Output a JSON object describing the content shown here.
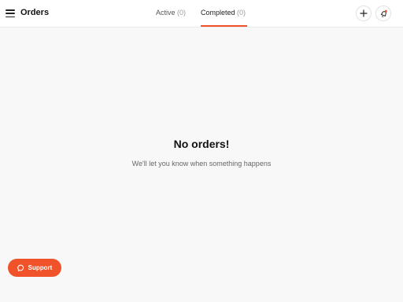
{
  "header": {
    "title": "Orders",
    "menu_icon": "hamburger-icon",
    "add_icon": "plus-icon",
    "notify_icon": "bell-icon",
    "accent_color": "#f0532a"
  },
  "tabs": [
    {
      "label": "Active",
      "count": "(0)",
      "selected": false
    },
    {
      "label": "Completed",
      "count": "(0)",
      "selected": true
    }
  ],
  "empty_state": {
    "title": "No orders!",
    "subtitle": "We'll let you know when something happens"
  },
  "support": {
    "label": "Support",
    "icon": "chat-bubble-icon"
  }
}
